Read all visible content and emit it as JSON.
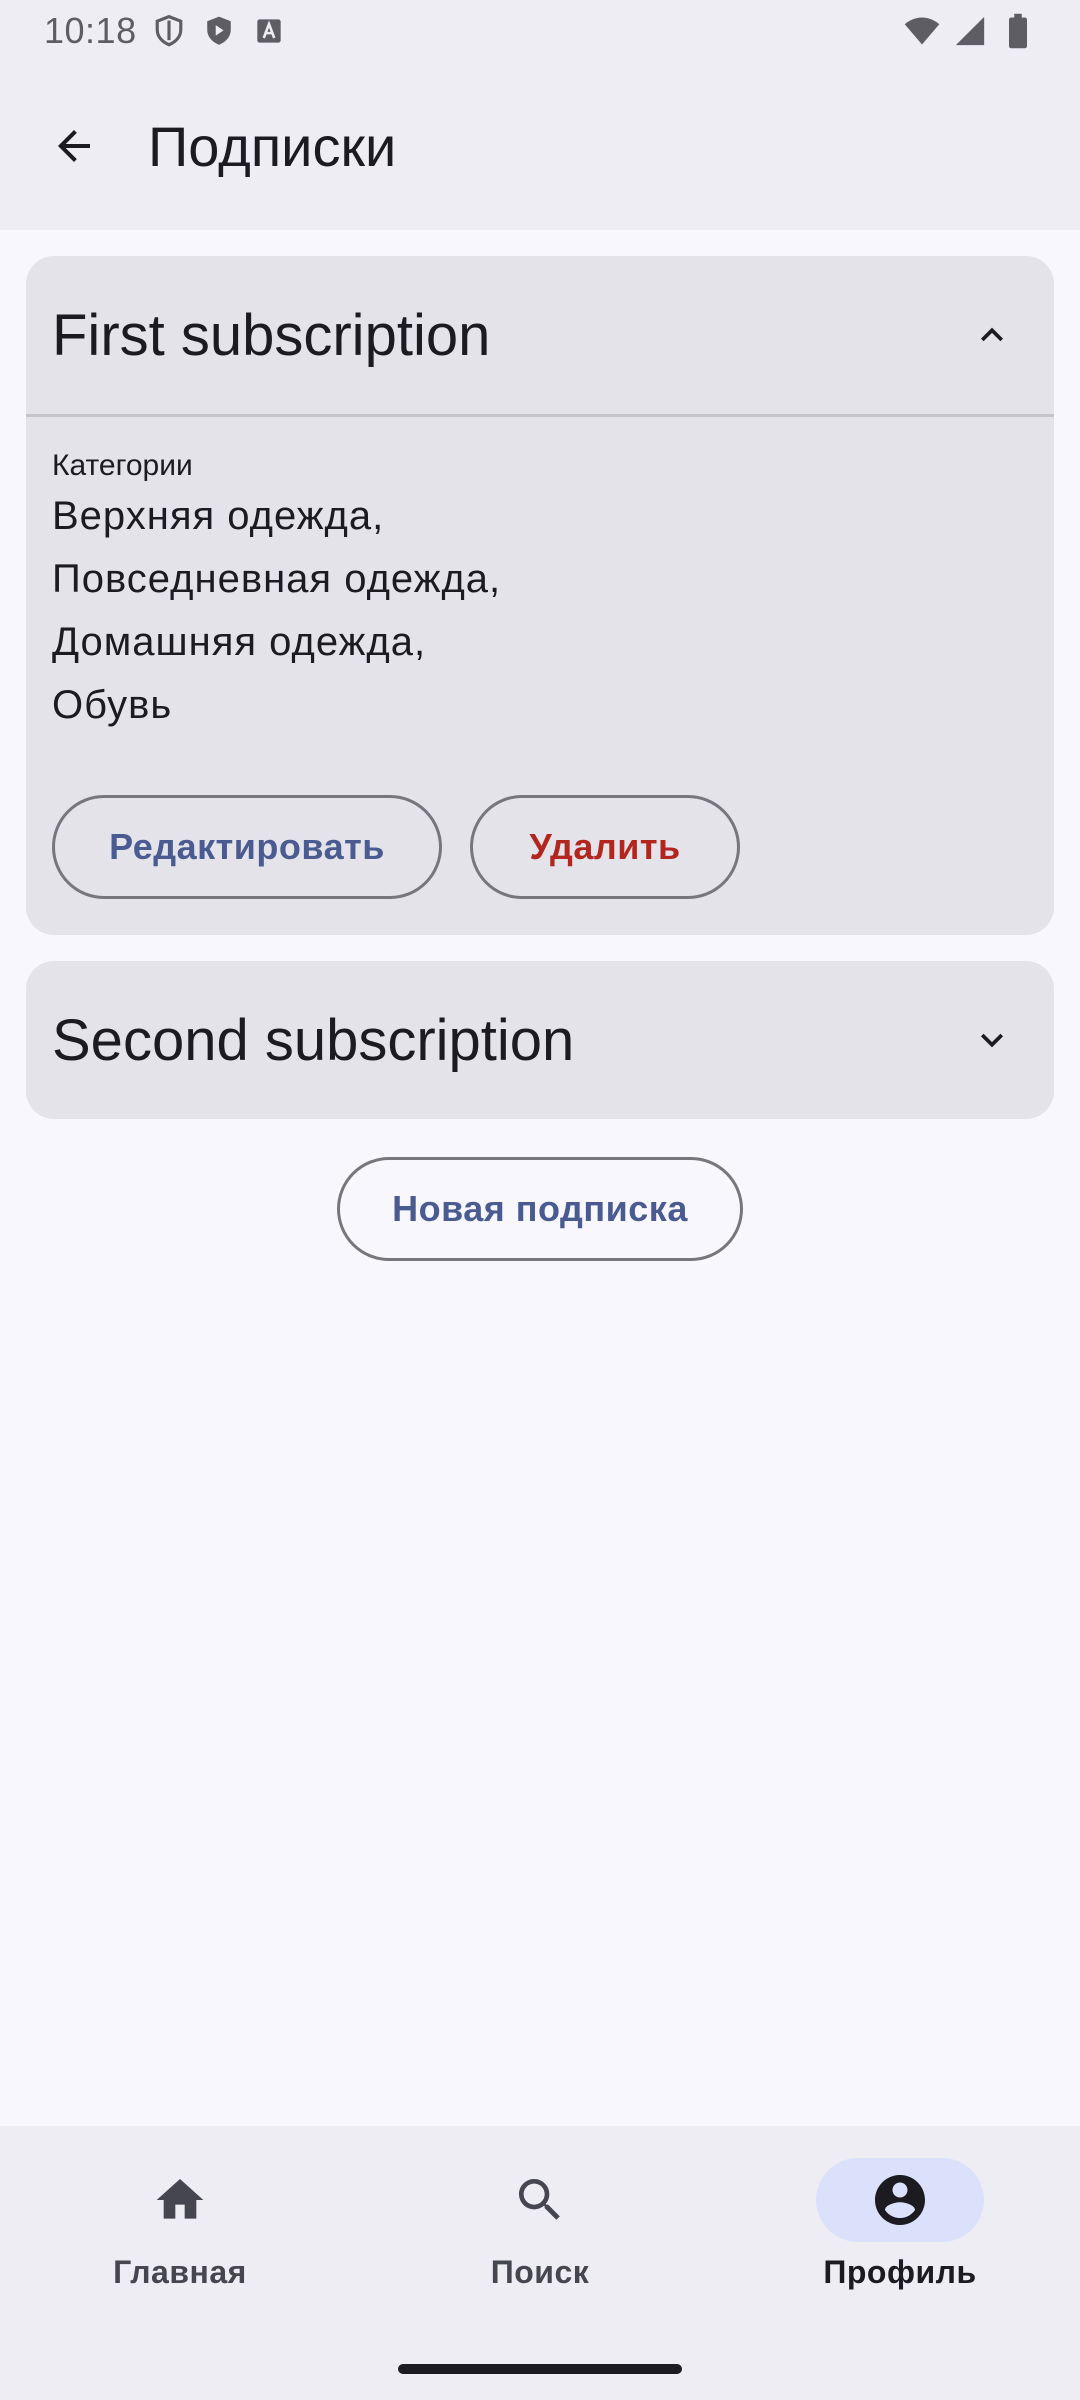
{
  "status_bar": {
    "time": "10:18",
    "left_icons": [
      "shield-outline-icon",
      "shield-play-icon",
      "translate-a-icon"
    ],
    "right_icons": [
      "wifi-icon",
      "signal-icon",
      "battery-icon"
    ]
  },
  "top_bar": {
    "back_icon": "arrow-back-icon",
    "title": "Подписки"
  },
  "subscriptions": [
    {
      "title": "First subscription",
      "expanded": true,
      "chevron": "chevron-up-icon",
      "categories_label": "Категории",
      "categories": [
        "Верхняя одежда,",
        "Повседневная одежда,",
        "Домашняя одежда,",
        "Обувь"
      ],
      "edit_label": "Редактировать",
      "delete_label": "Удалить"
    },
    {
      "title": "Second subscription",
      "expanded": false,
      "chevron": "chevron-down-icon"
    }
  ],
  "new_subscription_label": "Новая подписка",
  "bottom_nav": {
    "items": [
      {
        "label": "Главная",
        "icon": "home-icon",
        "active": false
      },
      {
        "label": "Поиск",
        "icon": "search-icon",
        "active": false
      },
      {
        "label": "Профиль",
        "icon": "account-circle-icon",
        "active": true
      }
    ]
  },
  "colors": {
    "accent_text": "#4a5b91",
    "danger_text": "#b3261e",
    "card_bg": "#e4e3ea",
    "bar_bg": "#eeedf4",
    "active_nav_indicator": "#dbe1fa"
  }
}
